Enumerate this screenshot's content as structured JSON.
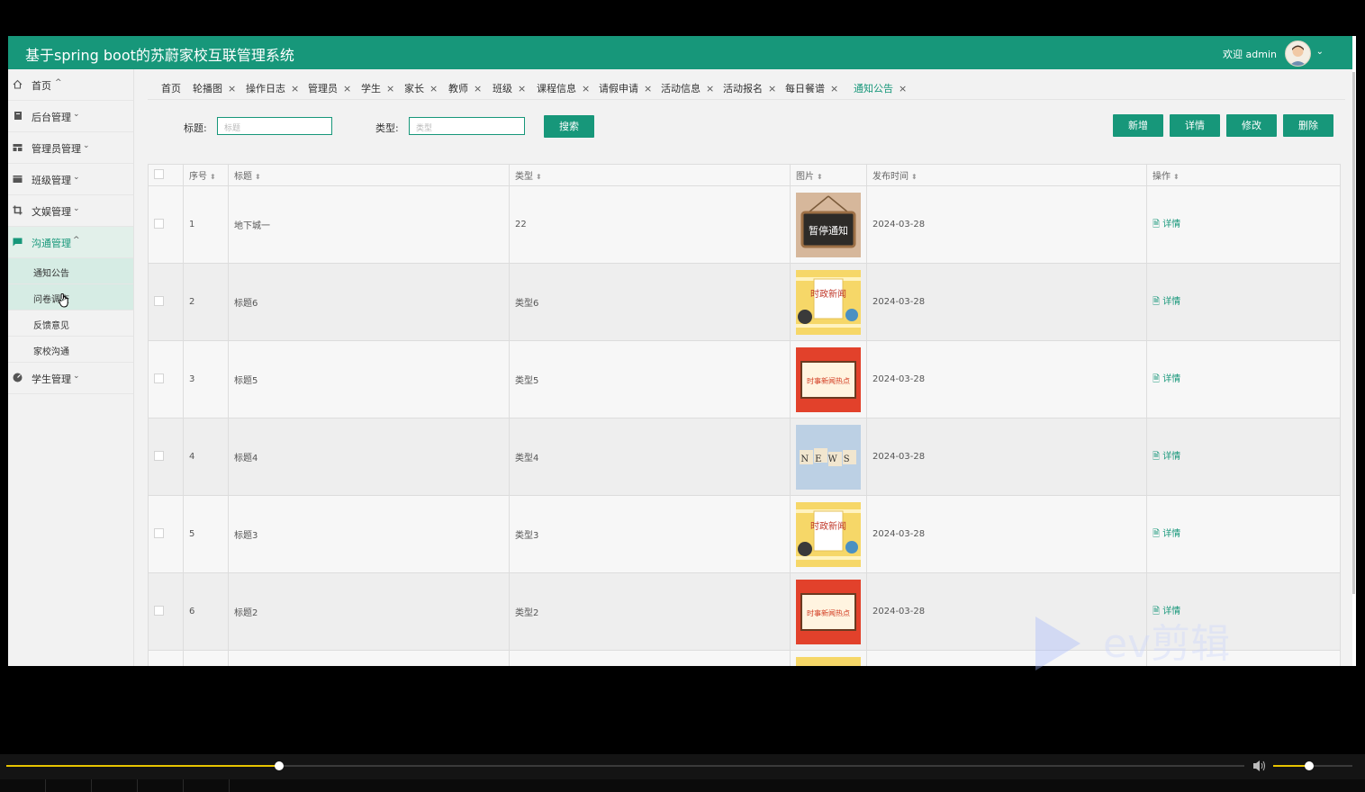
{
  "header": {
    "title": "基于spring boot的苏蔚家校互联管理系统",
    "welcome": "欢迎 admin"
  },
  "sidebar": {
    "menus": [
      {
        "label": "首页",
        "icon": "home-icon",
        "chevron": "^"
      },
      {
        "label": "后台管理",
        "icon": "book-icon",
        "chevron": "v"
      },
      {
        "label": "管理员管理",
        "icon": "table-icon",
        "chevron": "v"
      },
      {
        "label": "班级管理",
        "icon": "card-icon",
        "chevron": "v"
      },
      {
        "label": "文娱管理",
        "icon": "crop-icon",
        "chevron": "v"
      },
      {
        "label": "沟通管理",
        "icon": "chat-icon",
        "chevron": "^"
      },
      {
        "label": "学生管理",
        "icon": "dashboard-icon",
        "chevron": "v"
      }
    ],
    "submenu": [
      "通知公告",
      "问卷调查",
      "反馈意见",
      "家校沟通"
    ]
  },
  "tabs": [
    "首页",
    "轮播图",
    "操作日志",
    "管理员",
    "学生",
    "家长",
    "教师",
    "班级",
    "课程信息",
    "请假申请",
    "活动信息",
    "活动报名",
    "每日餐谱",
    "通知公告"
  ],
  "search": {
    "title_label": "标题:",
    "title_placeholder": "标题",
    "type_label": "类型:",
    "type_placeholder": "类型",
    "search_button": "搜索"
  },
  "actions": {
    "add": "新增",
    "detail": "详情",
    "edit": "修改",
    "delete": "删除"
  },
  "table": {
    "columns": [
      "序号",
      "标题",
      "类型",
      "图片",
      "发布时间",
      "操作"
    ],
    "rows": [
      {
        "no": "1",
        "title": "地下城一",
        "type": "22",
        "image": "暂停通知",
        "time": "2024-03-28",
        "op": "详情"
      },
      {
        "no": "2",
        "title": "标题6",
        "type": "类型6",
        "image": "时政新闻",
        "time": "2024-03-28",
        "op": "详情"
      },
      {
        "no": "3",
        "title": "标题5",
        "type": "类型5",
        "image": "时事新闻热点",
        "time": "2024-03-28",
        "op": "详情"
      },
      {
        "no": "4",
        "title": "标题4",
        "type": "类型4",
        "image": "NEWS",
        "time": "2024-03-28",
        "op": "详情"
      },
      {
        "no": "5",
        "title": "标题3",
        "type": "类型3",
        "image": "时政新闻",
        "time": "2024-03-28",
        "op": "详情"
      },
      {
        "no": "6",
        "title": "标题2",
        "type": "类型2",
        "image": "时事新闻热点",
        "time": "2024-03-28",
        "op": "详情"
      }
    ]
  },
  "watermark": "ev剪辑",
  "player": {
    "progress": 0.22,
    "volume": 0.45
  },
  "colors": {
    "brand": "#17977a",
    "background": "#f2f2f2"
  }
}
